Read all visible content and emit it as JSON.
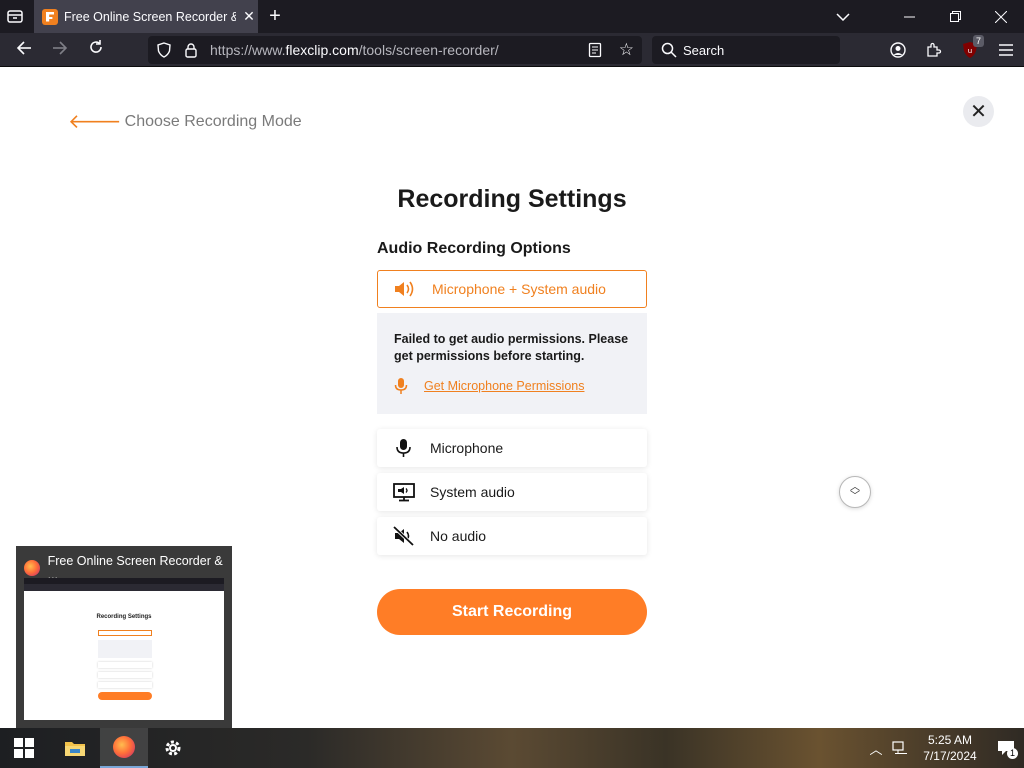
{
  "browser": {
    "tab_title": "Free Online Screen Recorder & Video",
    "url_prefix": "https://www.",
    "url_domain": "flexclip.com",
    "url_path": "/tools/screen-recorder/",
    "search_placeholder": "Search",
    "extension_badge": "7"
  },
  "page": {
    "back_label": "Choose Recording Mode",
    "title": "Recording Settings",
    "audio_section_label": "Audio Recording Options",
    "selected_option": "Microphone + System audio",
    "warning_text": "Failed to get audio permissions. Please get permissions before starting.",
    "permission_link": "Get Microphone Permissions",
    "options": [
      {
        "label": "Microphone",
        "icon": "microphone-icon"
      },
      {
        "label": "System audio",
        "icon": "monitor-speaker-icon"
      },
      {
        "label": "No audio",
        "icon": "mute-icon"
      }
    ],
    "start_button": "Start Recording",
    "accent_color": "#f0801f",
    "button_color": "#ff7d26"
  },
  "preview": {
    "title": "Free Online Screen Recorder & ...",
    "thumb_title": "Recording Settings"
  },
  "taskbar": {
    "time": "5:25 AM",
    "date": "7/17/2024",
    "notification_count": "1"
  }
}
